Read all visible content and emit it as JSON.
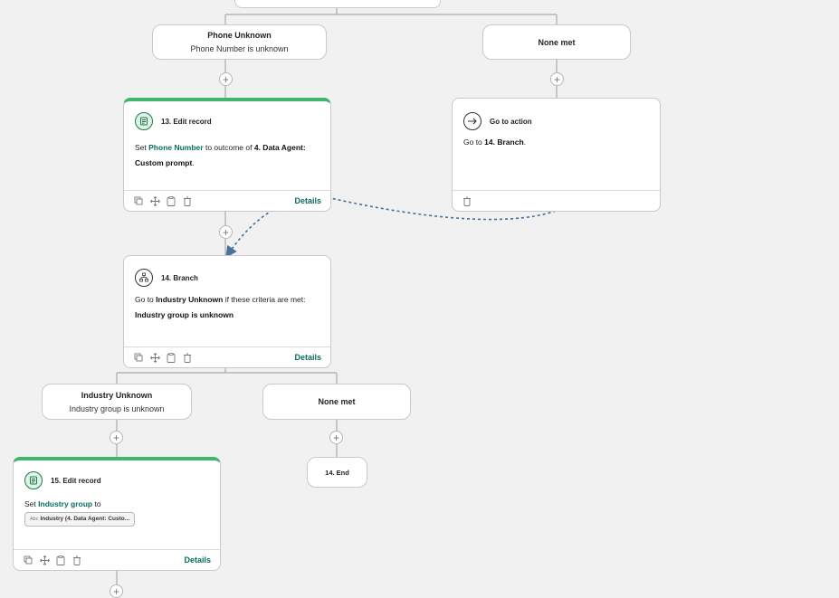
{
  "flow": {
    "branch_phone_unknown": {
      "title": "Phone Unknown",
      "subtitle": "Phone Number is unknown"
    },
    "branch_none_met_1": {
      "title": "None met"
    },
    "card13": {
      "title": "13. Edit record",
      "set_word": "Set",
      "field": "Phone Number",
      "mid": "to outcome of",
      "source": "4. Data Agent: Custom prompt",
      "end": ".",
      "details_label": "Details"
    },
    "go_to_action": {
      "title": "Go to action",
      "prefix": "Go to",
      "target": "14. Branch",
      "end": "."
    },
    "card14": {
      "title": "14. Branch",
      "prefix": "Go to",
      "target": "Industry Unknown",
      "mid": "if these criteria are met:",
      "criteria": "Industry group is unknown",
      "details_label": "Details"
    },
    "branch_industry_unknown": {
      "title": "Industry Unknown",
      "subtitle": "Industry group is unknown"
    },
    "branch_none_met_2": {
      "title": "None met"
    },
    "end_node": {
      "label": "14. End"
    },
    "card15": {
      "title": "15. Edit record",
      "set_word": "Set",
      "field": "Industry group",
      "mid": "to",
      "pill_prefix": "Abc",
      "pill_text": "Industry (4. Data Agent: Custo...",
      "details_label": "Details"
    },
    "add_symbol": "+"
  },
  "colors": {
    "accent_green": "#3fb66c",
    "link_teal": "#0b6b63",
    "dashed_arrow": "#4a6f9a",
    "canvas_bg": "#f1f1f1"
  },
  "icons": {
    "edit_record": "document-edit-icon",
    "go_to": "arrow-right-circle-icon",
    "branch": "branch-icon",
    "copy": "copy-icon",
    "move": "move-icon",
    "clipboard": "clipboard-icon",
    "delete": "trash-icon"
  }
}
